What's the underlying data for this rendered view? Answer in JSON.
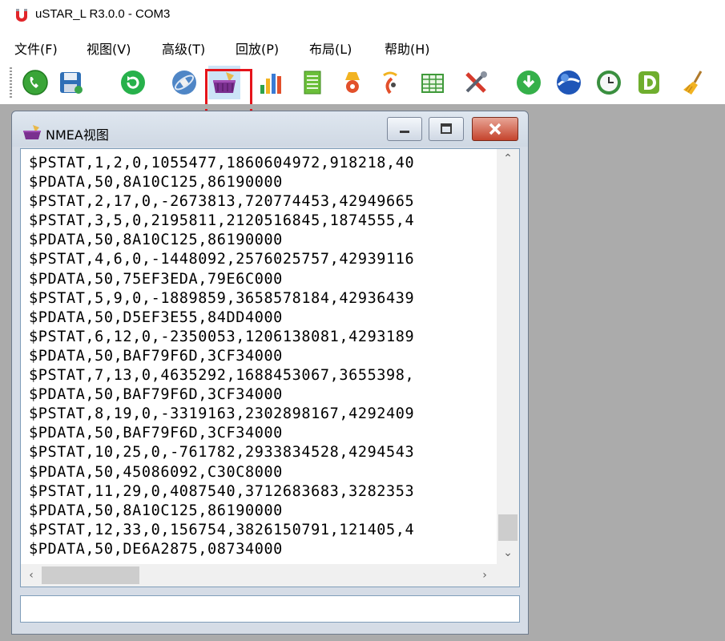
{
  "app": {
    "title": "uSTAR_L R3.0.0 - COM3"
  },
  "menu": [
    {
      "label": "文件(F)"
    },
    {
      "label": "视图(V)"
    },
    {
      "label": "高级(T)"
    },
    {
      "label": "回放(P)"
    },
    {
      "label": "布局(L)"
    },
    {
      "label": "帮助(H)"
    }
  ],
  "toolbar": {
    "buttons": [
      {
        "icon": "phone-connect-icon"
      },
      {
        "icon": "save-icon"
      },
      {
        "icon": "refresh-icon"
      },
      {
        "icon": "satellite-icon"
      },
      {
        "icon": "nmea-basket-icon",
        "active": true
      },
      {
        "icon": "bar-chart-icon"
      },
      {
        "icon": "list-icon"
      },
      {
        "icon": "location-icon"
      },
      {
        "icon": "signal-icon"
      },
      {
        "icon": "table-icon"
      },
      {
        "icon": "tools-icon"
      },
      {
        "icon": "download-icon"
      },
      {
        "icon": "globe-icon"
      },
      {
        "icon": "clock-icon"
      },
      {
        "icon": "d-icon"
      },
      {
        "icon": "broom-icon"
      }
    ],
    "highlight_color": "#e5141b"
  },
  "nmea_window": {
    "title": "NMEA视图",
    "lines": [
      "$PSTAT,1,2,0,1055477,1860604972,918218,40",
      "$PDATA,50,8A10C125,86190000",
      "$PSTAT,2,17,0,-2673813,720774453,42949665",
      "$PSTAT,3,5,0,2195811,2120516845,1874555,4",
      "$PDATA,50,8A10C125,86190000",
      "$PSTAT,4,6,0,-1448092,2576025757,42939116",
      "$PDATA,50,75EF3EDA,79E6C000",
      "$PSTAT,5,9,0,-1889859,3658578184,42936439",
      "$PDATA,50,D5EF3E55,84DD4000",
      "$PSTAT,6,12,0,-2350053,1206138081,4293189",
      "$PDATA,50,BAF79F6D,3CF34000",
      "$PSTAT,7,13,0,4635292,1688453067,3655398,",
      "$PDATA,50,BAF79F6D,3CF34000",
      "$PSTAT,8,19,0,-3319163,2302898167,4292409",
      "$PDATA,50,BAF79F6D,3CF34000",
      "$PSTAT,10,25,0,-761782,2933834528,4294543",
      "$PDATA,50,45086092,C30C8000",
      "$PSTAT,11,29,0,4087540,3712683683,3282353",
      "$PDATA,50,8A10C125,86190000",
      "$PSTAT,12,33,0,156754,3826150791,121405,4",
      "$PDATA,50,DE6A2875,08734000"
    ],
    "input_value": ""
  }
}
